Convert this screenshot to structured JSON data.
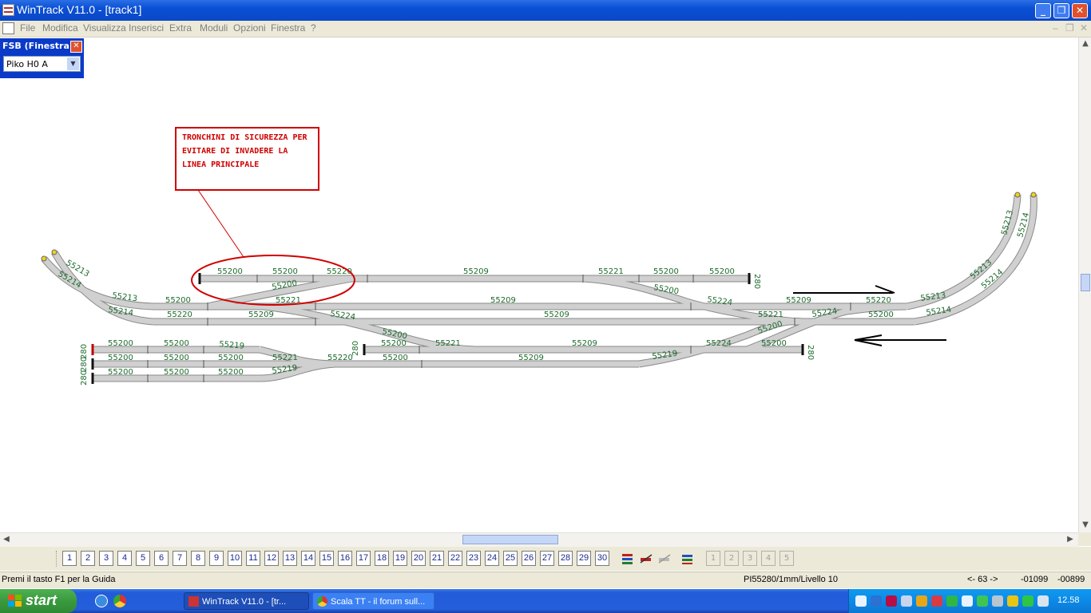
{
  "window": {
    "title": "WinTrack  V11.0 - [track1]"
  },
  "menu": [
    "File",
    "Modifica",
    "Visualizza",
    "Inserisci",
    "Extra",
    "Moduli",
    "Opzioni",
    "Finestra",
    "?"
  ],
  "fsb": {
    "title": "FSB (Finestra...",
    "selected": "Piko H0  A"
  },
  "annotation": {
    "text": "TRONCHINI DI SICUREZZA PER EVITARE DI INVADERE LA LINEA PRINCIPALE"
  },
  "track_labels": {
    "l55200": "55200",
    "l55209": "55209",
    "l55220": "55220",
    "l55221": "55221",
    "l55213": "55213",
    "l55214": "55214",
    "l55219": "55219",
    "l55224": "55224",
    "l280": "280"
  },
  "toolbar": {
    "layers": [
      "1",
      "2",
      "3",
      "4",
      "5",
      "6",
      "7",
      "8",
      "9",
      "10",
      "11",
      "12",
      "13",
      "14",
      "15",
      "16",
      "17",
      "18",
      "19",
      "20",
      "21",
      "22",
      "23",
      "24",
      "25",
      "26",
      "27",
      "28",
      "29",
      "30"
    ],
    "extra": [
      "1",
      "2",
      "3",
      "4",
      "5"
    ]
  },
  "status": {
    "help": "Premi il tasto F1 per la Guida",
    "info": "PI55280/1mm/Livello 10",
    "zoom": "<- 63 ->",
    "x": "-01099",
    "y": "-00899"
  },
  "taskbar": {
    "start": "start",
    "task1": "WinTrack  V11.0 - [tr...",
    "task2": "Scala TT - il forum sull...",
    "clock": "12.58"
  },
  "colors": {
    "titlebar": "#0a4fd4",
    "track": "#c8c8c8",
    "label": "#1c6b2c",
    "annotation": "#d00000"
  }
}
